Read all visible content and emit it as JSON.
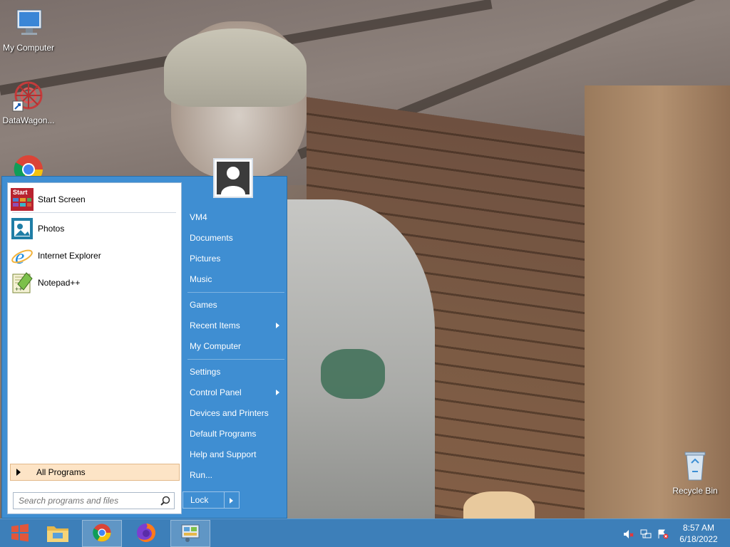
{
  "desktop": {
    "icons": [
      {
        "label": "My Computer",
        "icon": "my-computer-icon"
      },
      {
        "label": "DataWagon...",
        "icon": "datawagon-icon"
      },
      {
        "label": "",
        "icon": "chrome-icon"
      },
      {
        "label": "Recycle Bin",
        "icon": "recycle-bin-icon"
      }
    ]
  },
  "start_menu": {
    "pinned": [
      {
        "label": "Start Screen",
        "icon": "start-screen-icon"
      },
      {
        "label": "Photos",
        "icon": "photos-icon"
      },
      {
        "label": "Internet Explorer",
        "icon": "internet-explorer-icon"
      },
      {
        "label": "Notepad++",
        "icon": "notepad-plus-plus-icon"
      }
    ],
    "start_screen_badge": "Start",
    "all_programs": "All Programs",
    "search_placeholder": "Search programs and files",
    "right": [
      {
        "label": "VM4"
      },
      {
        "label": "Documents"
      },
      {
        "label": "Pictures"
      },
      {
        "label": "Music"
      },
      {
        "label": "Games"
      },
      {
        "label": "Recent Items",
        "submenu": true
      },
      {
        "label": "My Computer"
      },
      {
        "label": "Settings"
      },
      {
        "label": "Control Panel",
        "submenu": true
      },
      {
        "label": "Devices and Printers"
      },
      {
        "label": "Default Programs"
      },
      {
        "label": "Help and Support"
      },
      {
        "label": "Run..."
      }
    ],
    "lock": "Lock"
  },
  "taskbar": {
    "buttons": [
      {
        "name": "start",
        "icon": "windows-logo-icon"
      },
      {
        "name": "file-explorer",
        "icon": "folder-icon"
      },
      {
        "name": "chrome",
        "icon": "chrome-icon",
        "active": true
      },
      {
        "name": "firefox",
        "icon": "firefox-icon"
      },
      {
        "name": "control-panel",
        "icon": "control-panel-icon",
        "active": true
      }
    ],
    "tray": [
      "volume-muted-icon",
      "network-icon",
      "action-center-icon"
    ],
    "time": "8:57 AM",
    "date": "6/18/2022"
  }
}
